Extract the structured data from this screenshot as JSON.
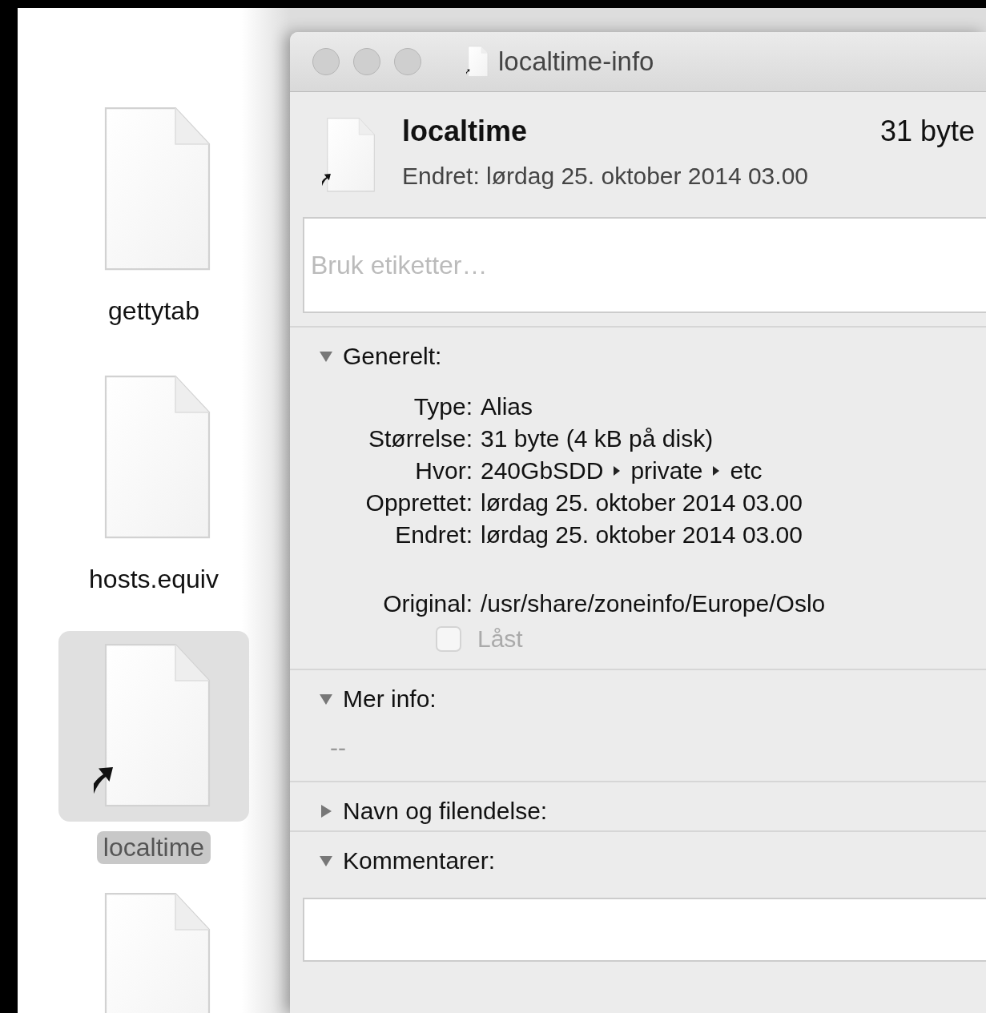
{
  "finder_files": [
    {
      "name": "gettytab",
      "selected": false,
      "alias": false
    },
    {
      "name": "hosts.equiv",
      "selected": false,
      "alias": false
    },
    {
      "name": "localtime",
      "selected": true,
      "alias": true
    }
  ],
  "info_window": {
    "title": "localtime-info",
    "file_name": "localtime",
    "size": "31 byte",
    "modified": "Endret: lørdag 25. oktober 2014 03.00",
    "tags_placeholder": "Bruk etiketter…",
    "sections": [
      {
        "title": "Generelt:",
        "expanded": true,
        "kind": "properties",
        "rows": [
          {
            "label": "Type:",
            "value": "Alias"
          },
          {
            "label": "Størrelse:",
            "value": "31 byte (4 kB på disk)"
          },
          {
            "label": "Hvor:",
            "path": [
              "240GbSDD",
              "private",
              "etc"
            ]
          },
          {
            "label": "Opprettet:",
            "value": "lørdag 25. oktober 2014 03.00"
          },
          {
            "label": "Endret:",
            "value": "lørdag 25. oktober 2014 03.00"
          },
          {
            "label": "Original:",
            "value": "/usr/share/zoneinfo/Europe/Oslo",
            "gap_before": true
          }
        ],
        "lock": {
          "label": "Låst",
          "checked": false,
          "disabled": true
        }
      },
      {
        "title": "Mer info:",
        "expanded": true,
        "kind": "text",
        "text": "--"
      },
      {
        "title": "Navn og filendelse:",
        "expanded": false
      },
      {
        "title": "Kommentarer:",
        "expanded": true,
        "kind": "comment"
      }
    ]
  }
}
